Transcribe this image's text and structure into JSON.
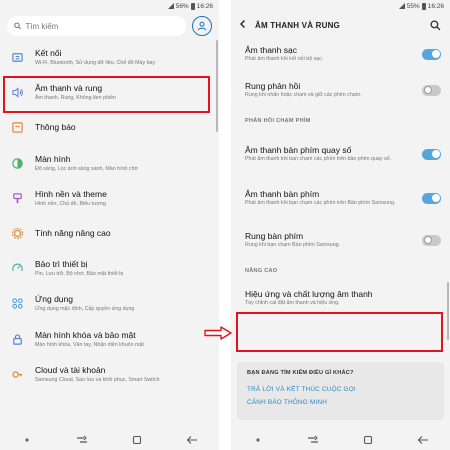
{
  "status_bar": {
    "battery_left": "56%",
    "time_left": "16:26",
    "battery_right": "55%",
    "time_right": "16:26"
  },
  "left": {
    "search": {
      "placeholder": "Tìm kiếm"
    },
    "items": [
      {
        "title": "Kết nối",
        "subtitle": "Wi-Fi, Bluetooth, Sử dụng dữ liệu, Chế độ Máy bay",
        "icon": "connection-icon"
      },
      {
        "title": "Âm thanh và rung",
        "subtitle": "Âm thanh, Rung, Không làm phiền",
        "icon": "speaker-icon"
      },
      {
        "title": "Thông báo",
        "subtitle": "",
        "icon": "notification-icon"
      },
      {
        "title": "Màn hình",
        "subtitle": "Độ sáng, Lọc ánh sáng xanh, Màn hình chờ",
        "icon": "display-icon"
      },
      {
        "title": "Hình nền và theme",
        "subtitle": "Hình nền, Chủ đề, Biểu tượng",
        "icon": "brush-icon"
      },
      {
        "title": "Tính năng nâng cao",
        "subtitle": "",
        "icon": "gear-icon"
      },
      {
        "title": "Bảo trì thiết bị",
        "subtitle": "Pin, Lưu trữ, Bộ nhớ, Bảo mật thiết bị",
        "icon": "maintenance-icon"
      },
      {
        "title": "Ứng dụng",
        "subtitle": "Ứng dụng mặc định, Cấp quyền ứng dụng",
        "icon": "apps-icon"
      },
      {
        "title": "Màn hình khóa và bảo mật",
        "subtitle": "Màn hình khóa, Vân tay, Nhận diện khuôn mặt",
        "icon": "lock-icon"
      },
      {
        "title": "Cloud và tài khoản",
        "subtitle": "Samsung Cloud, Sao lưu và khôi phục, Smart Switch",
        "icon": "key-icon"
      }
    ]
  },
  "right": {
    "header": {
      "title": "ÂM THANH VÀ RUNG"
    },
    "items": [
      {
        "title": "Âm thanh sạc",
        "subtitle": "Phát âm thanh khi kết nối bộ sạc.",
        "toggle": true
      },
      {
        "title": "Rung phản hồi",
        "subtitle": "Rung khi nhấn hoặc chạm và giữ các phím chạm.",
        "toggle": false
      }
    ],
    "section_keyboard": "PHẢN HỒI CHẠM PHÍM",
    "keyboard_items": [
      {
        "title": "Âm thanh bàn phím quay số",
        "subtitle": "Phát âm thanh khi bạn chạm các phím trên bàn phím quay số.",
        "toggle": true
      },
      {
        "title": "Âm thanh bàn phím",
        "subtitle": "Phát âm thanh khi bạn chạm các phím trên Bàn phím Samsung.",
        "toggle": true
      },
      {
        "title": "Rung bàn phím",
        "subtitle": "Rung khi bạn chạm Bàn phím Samsung.",
        "toggle": false
      }
    ],
    "section_advanced": "NÂNG CAO",
    "advanced_item": {
      "title": "Hiệu ứng và chất lượng âm thanh",
      "subtitle": "Tùy chỉnh cài đặt âm thanh và hiệu ứng."
    },
    "suggest": {
      "title": "BẠN ĐANG TÌM KIẾM ĐIỀU GÌ KHÁC?",
      "links": [
        "TRẢ LỜI VÀ KẾT THÚC CUỘC GỌI",
        "CẢNH BÁO THÔNG MINH"
      ]
    }
  },
  "colors": {
    "highlight": "#e0141e",
    "accent": "#56a5dc",
    "link": "#2c86c2"
  }
}
